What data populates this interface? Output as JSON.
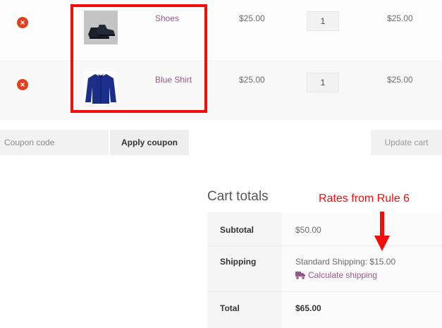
{
  "cart": {
    "items": [
      {
        "name": "Shoes",
        "price": "$25.00",
        "quantity": "1",
        "subtotal": "$25.00"
      },
      {
        "name": "Blue Shirt",
        "price": "$25.00",
        "quantity": "1",
        "subtotal": "$25.00"
      }
    ],
    "remove_glyph": "×"
  },
  "coupon": {
    "placeholder": "Coupon code",
    "apply_label": "Apply coupon"
  },
  "update_label": "Update cart",
  "totals": {
    "title": "Cart totals",
    "subtotal_label": "Subtotal",
    "subtotal_value": "$50.00",
    "shipping_label": "Shipping",
    "shipping_value": "Standard Shipping: $15.00",
    "calc_shipping": "Calculate shipping",
    "total_label": "Total",
    "total_value": "$65.00"
  },
  "annotation": {
    "text": "Rates from Rule 6",
    "color": "#f20d0d"
  },
  "colors": {
    "link": "#96588a",
    "remove": "#e2401c"
  },
  "icons": {
    "remove": "remove-icon",
    "truck": "truck-icon",
    "arrow": "arrow-down-icon"
  }
}
